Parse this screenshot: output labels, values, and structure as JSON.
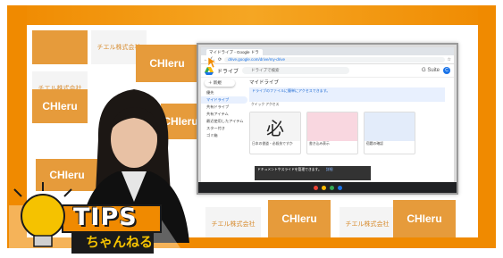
{
  "backdrop": {
    "brand": "CHIeru",
    "company_jp": "チエル株式会社"
  },
  "browser": {
    "tab_title": "マイドライブ - Google ドライ",
    "url": "drive.google.com/drive/my-drive"
  },
  "drive": {
    "app_name": "ドライブ",
    "search_placeholder": "ドライブで検索",
    "gsuite_label": "G Suite",
    "avatar_letter": "C",
    "new_button": "新規",
    "nav": [
      {
        "label": "優先"
      },
      {
        "label": "マイドライブ"
      },
      {
        "label": "共有ドライブ"
      },
      {
        "label": "共有アイテム"
      },
      {
        "label": "最近使用したアイテム"
      },
      {
        "label": "スター付き"
      },
      {
        "label": "ゴミ箱"
      }
    ],
    "page_title": "マイドライブ",
    "banner_text": "ドライブのファイルに簡単にアクセスできます。",
    "section_label": "クイック アクセス",
    "cards": [
      {
        "thumb": "必",
        "caption": "日本の書道・必殺技ですか"
      },
      {
        "thumb": "",
        "caption": "書き込み表示"
      },
      {
        "thumb": "",
        "caption": "宿題の確認"
      }
    ],
    "toast_text": "ドキュメントやスライドを管理できます。",
    "toast_action": "詳細"
  },
  "overlay": {
    "tips_title": "TIPS",
    "tips_subtitle": "ちゃんねる"
  },
  "colors": {
    "orange": "#f08a00",
    "drive_blue": "#1a73e8",
    "tips_yellow": "#f5c200"
  }
}
